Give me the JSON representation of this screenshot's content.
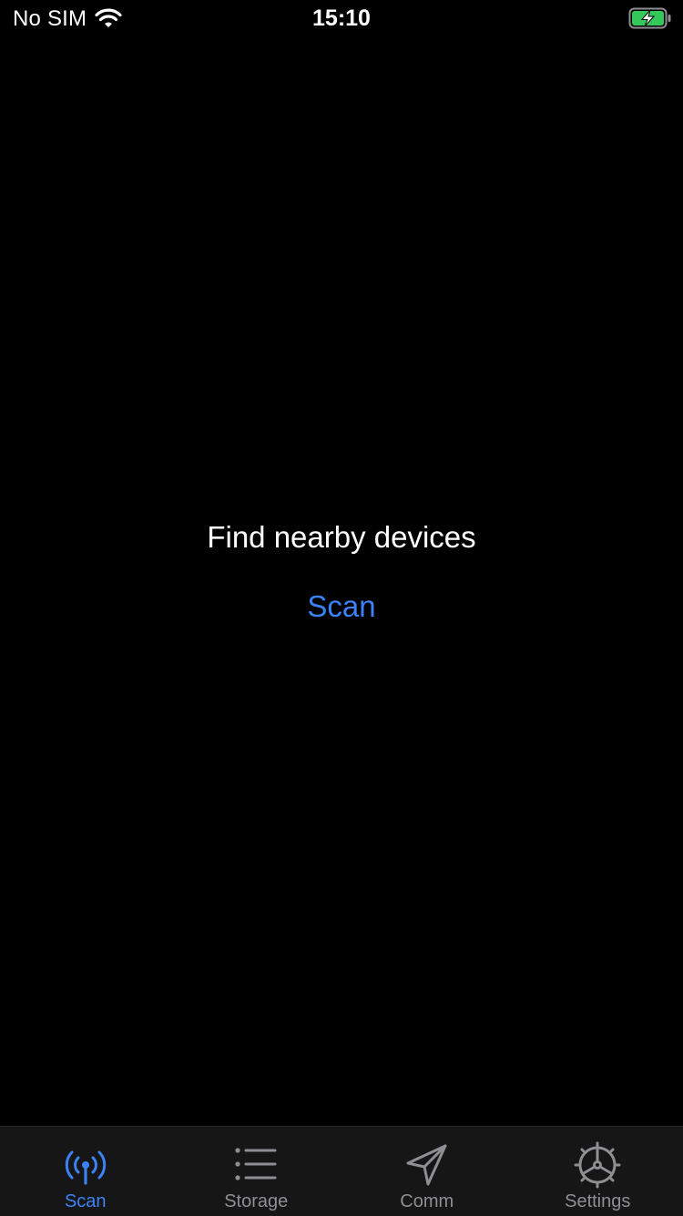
{
  "status_bar": {
    "carrier": "No SIM",
    "time": "15:10",
    "wifi_icon": "wifi-icon",
    "battery_icon": "battery-charging-icon",
    "battery_color": "#34c759"
  },
  "main": {
    "prompt": "Find nearby devices",
    "scan_button_label": "Scan"
  },
  "tab_bar": {
    "active_color": "#3b82f6",
    "inactive_color": "#8e8e93",
    "tabs": [
      {
        "label": "Scan",
        "icon": "antenna-icon",
        "active": true
      },
      {
        "label": "Storage",
        "icon": "list-icon",
        "active": false
      },
      {
        "label": "Comm",
        "icon": "paper-plane-icon",
        "active": false
      },
      {
        "label": "Settings",
        "icon": "gear-icon",
        "active": false
      }
    ]
  }
}
